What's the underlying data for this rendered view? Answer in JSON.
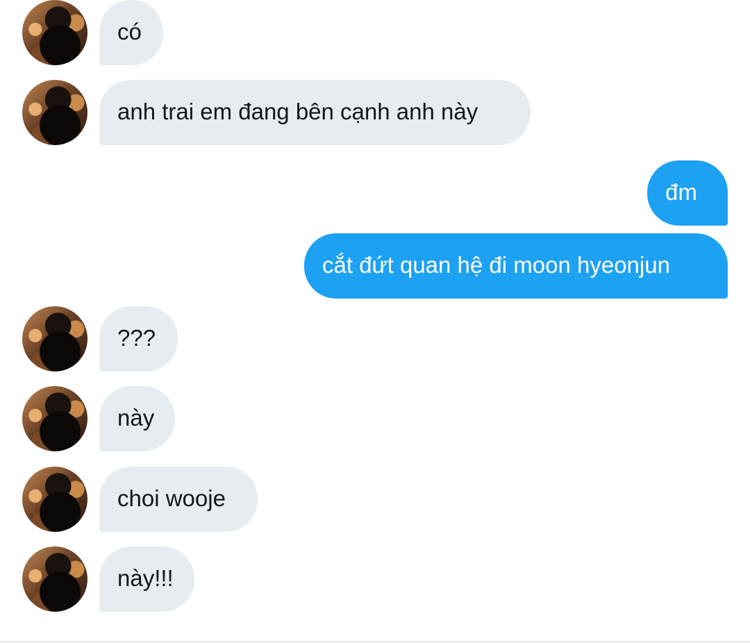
{
  "messages": [
    {
      "side": "in",
      "text": "có"
    },
    {
      "side": "in",
      "text": "anh trai em đang bên cạnh anh này"
    },
    {
      "side": "out",
      "text": "đm"
    },
    {
      "side": "out",
      "text": "cắt đứt quan hệ đi moon hyeonjun"
    },
    {
      "side": "in",
      "text": "???"
    },
    {
      "side": "in",
      "text": "này"
    },
    {
      "side": "in",
      "text": "choi wooje"
    },
    {
      "side": "in",
      "text": "này!!!"
    }
  ],
  "colors": {
    "incoming_bubble": "#e6ecf0",
    "outgoing_bubble": "#1da1f2",
    "incoming_text": "#14171a",
    "outgoing_text": "#ffffff"
  }
}
